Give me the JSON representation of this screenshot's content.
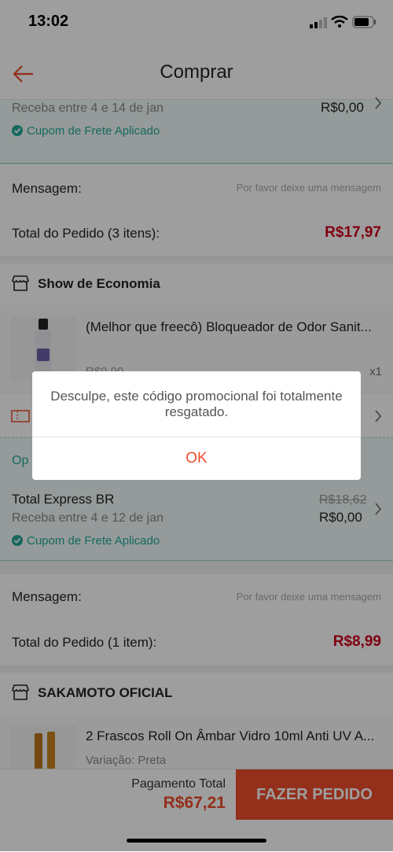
{
  "status": {
    "time": "13:02"
  },
  "header": {
    "title": "Comprar"
  },
  "shop1": {
    "delivery": "Receba entre 4 e 14 de jan",
    "shipping_price": "R$0,00",
    "coupon_applied": "Cupom de Frete Aplicado",
    "message_label": "Mensagem:",
    "message_placeholder": "Por favor deixe uma mensagem",
    "order_total_label": "Total do Pedido (3 itens):",
    "order_total_value": "R$17,97"
  },
  "shop2": {
    "name": "Show de Economia",
    "product_name": "(Melhor que freecô) Bloqueador de Odor Sanit...",
    "product_price_partial": "R$9,99",
    "quantity": "x1",
    "shipping_option_partial": "Op",
    "shipping_name": "Total Express BR",
    "shipping_old_price": "R$18,62",
    "shipping_price": "R$0,00",
    "delivery": "Receba entre 4 e 12 de jan",
    "coupon_applied": "Cupom de Frete Aplicado",
    "message_label": "Mensagem:",
    "message_placeholder": "Por favor deixe uma mensagem",
    "order_total_label": "Total do Pedido (1 item):",
    "order_total_value": "R$8,99"
  },
  "shop3": {
    "name": "SAKAMOTO OFICIAL",
    "product_name": "2 Frascos Roll On Âmbar Vidro 10ml Anti UV A...",
    "variation": "Variação: Preta"
  },
  "footer": {
    "payment_label": "Pagamento Total",
    "payment_value": "R$67,21",
    "order_button": "FAZER PEDIDO"
  },
  "dialog": {
    "message": "Desculpe, este código promocional foi totalmente resgatado.",
    "ok": "OK"
  },
  "colors": {
    "accent": "#ee4d2d",
    "green": "#26aa99",
    "price": "#d0011b"
  }
}
